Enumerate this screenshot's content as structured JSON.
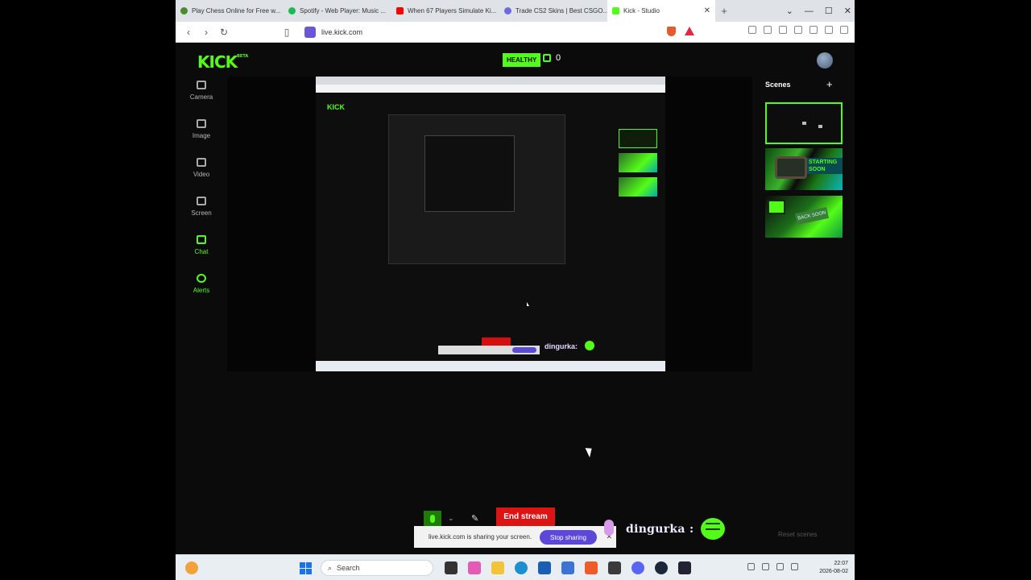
{
  "browser": {
    "tabs": [
      {
        "label": "Play Chess Online for Free w...",
        "fav": "#4c8a2e"
      },
      {
        "label": "Spotify - Web Player: Music ...",
        "fav": "#1db954"
      },
      {
        "label": "When 67 Players Simulate Ki...",
        "fav": "#ff0000"
      },
      {
        "label": "Trade CS2 Skins | Best CSGO...",
        "fav": "#6f6ae0"
      },
      {
        "label": "Kick - Studio",
        "fav": "#53fc18"
      }
    ],
    "url": "live.kick.com"
  },
  "kick": {
    "logo": "KICK",
    "logo_tag": "BETA",
    "health": "HEALTHY",
    "viewers": "0",
    "sidebar": [
      {
        "label": "Camera",
        "icon": "camera-icon"
      },
      {
        "label": "Image",
        "icon": "image-icon"
      },
      {
        "label": "Video",
        "icon": "video-icon"
      },
      {
        "label": "Screen",
        "icon": "screen-icon"
      },
      {
        "label": "Chat",
        "icon": "chat-icon"
      },
      {
        "label": "Alerts",
        "icon": "alerts-icon"
      }
    ],
    "scenes_title": "Scenes",
    "scene_add": "+",
    "scene2_text": "STARTING SOON",
    "scene3_text": "BACK SOON",
    "reset_scenes": "Reset scenes",
    "end_stream": "End stream",
    "preview_ding": "dingurka:"
  },
  "share_bar": {
    "text": "live.kick.com is sharing your screen.",
    "stop": "Stop sharing"
  },
  "chat_overlay": {
    "name": "dingurka :"
  },
  "taskbar": {
    "search": "Search",
    "time": "22:07",
    "date": "2026-08-02"
  },
  "colors": {
    "kick_green": "#53fc18",
    "end_red": "#de1414",
    "share_purple": "#5b48d8"
  }
}
